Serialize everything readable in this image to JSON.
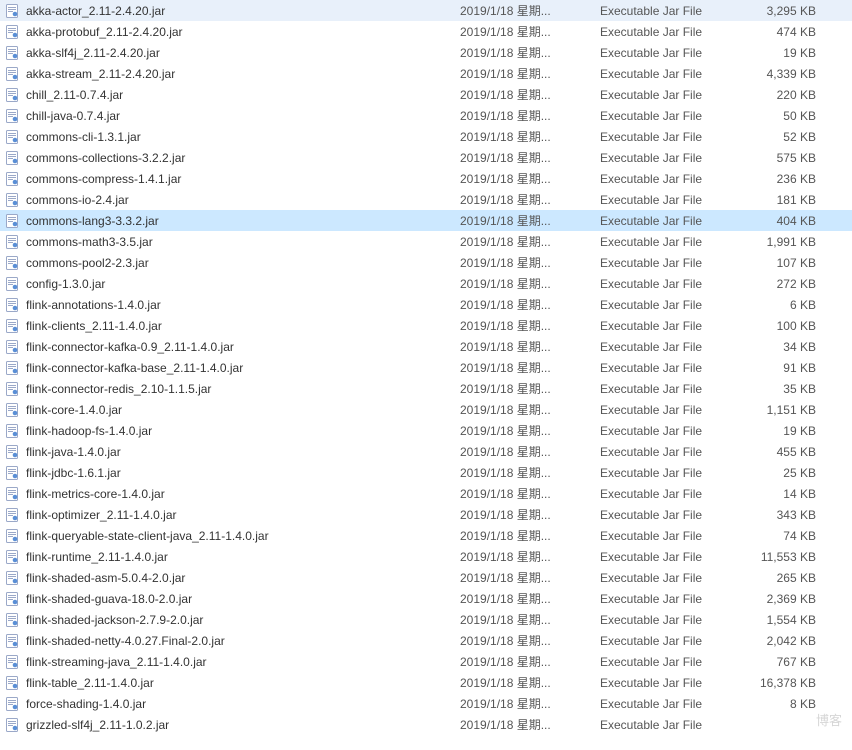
{
  "watermark": "博客",
  "icon_name": "jar-file-icon",
  "files": [
    {
      "name": "akka-actor_2.11-2.4.20.jar",
      "date": "2019/1/18 星期...",
      "type": "Executable Jar File",
      "size": "3,295 KB",
      "selected": false
    },
    {
      "name": "akka-protobuf_2.11-2.4.20.jar",
      "date": "2019/1/18 星期...",
      "type": "Executable Jar File",
      "size": "474 KB",
      "selected": false
    },
    {
      "name": "akka-slf4j_2.11-2.4.20.jar",
      "date": "2019/1/18 星期...",
      "type": "Executable Jar File",
      "size": "19 KB",
      "selected": false
    },
    {
      "name": "akka-stream_2.11-2.4.20.jar",
      "date": "2019/1/18 星期...",
      "type": "Executable Jar File",
      "size": "4,339 KB",
      "selected": false
    },
    {
      "name": "chill_2.11-0.7.4.jar",
      "date": "2019/1/18 星期...",
      "type": "Executable Jar File",
      "size": "220 KB",
      "selected": false
    },
    {
      "name": "chill-java-0.7.4.jar",
      "date": "2019/1/18 星期...",
      "type": "Executable Jar File",
      "size": "50 KB",
      "selected": false
    },
    {
      "name": "commons-cli-1.3.1.jar",
      "date": "2019/1/18 星期...",
      "type": "Executable Jar File",
      "size": "52 KB",
      "selected": false
    },
    {
      "name": "commons-collections-3.2.2.jar",
      "date": "2019/1/18 星期...",
      "type": "Executable Jar File",
      "size": "575 KB",
      "selected": false
    },
    {
      "name": "commons-compress-1.4.1.jar",
      "date": "2019/1/18 星期...",
      "type": "Executable Jar File",
      "size": "236 KB",
      "selected": false
    },
    {
      "name": "commons-io-2.4.jar",
      "date": "2019/1/18 星期...",
      "type": "Executable Jar File",
      "size": "181 KB",
      "selected": false
    },
    {
      "name": "commons-lang3-3.3.2.jar",
      "date": "2019/1/18 星期...",
      "type": "Executable Jar File",
      "size": "404 KB",
      "selected": true
    },
    {
      "name": "commons-math3-3.5.jar",
      "date": "2019/1/18 星期...",
      "type": "Executable Jar File",
      "size": "1,991 KB",
      "selected": false
    },
    {
      "name": "commons-pool2-2.3.jar",
      "date": "2019/1/18 星期...",
      "type": "Executable Jar File",
      "size": "107 KB",
      "selected": false
    },
    {
      "name": "config-1.3.0.jar",
      "date": "2019/1/18 星期...",
      "type": "Executable Jar File",
      "size": "272 KB",
      "selected": false
    },
    {
      "name": "flink-annotations-1.4.0.jar",
      "date": "2019/1/18 星期...",
      "type": "Executable Jar File",
      "size": "6 KB",
      "selected": false
    },
    {
      "name": "flink-clients_2.11-1.4.0.jar",
      "date": "2019/1/18 星期...",
      "type": "Executable Jar File",
      "size": "100 KB",
      "selected": false
    },
    {
      "name": "flink-connector-kafka-0.9_2.11-1.4.0.jar",
      "date": "2019/1/18 星期...",
      "type": "Executable Jar File",
      "size": "34 KB",
      "selected": false
    },
    {
      "name": "flink-connector-kafka-base_2.11-1.4.0.jar",
      "date": "2019/1/18 星期...",
      "type": "Executable Jar File",
      "size": "91 KB",
      "selected": false
    },
    {
      "name": "flink-connector-redis_2.10-1.1.5.jar",
      "date": "2019/1/18 星期...",
      "type": "Executable Jar File",
      "size": "35 KB",
      "selected": false
    },
    {
      "name": "flink-core-1.4.0.jar",
      "date": "2019/1/18 星期...",
      "type": "Executable Jar File",
      "size": "1,151 KB",
      "selected": false
    },
    {
      "name": "flink-hadoop-fs-1.4.0.jar",
      "date": "2019/1/18 星期...",
      "type": "Executable Jar File",
      "size": "19 KB",
      "selected": false
    },
    {
      "name": "flink-java-1.4.0.jar",
      "date": "2019/1/18 星期...",
      "type": "Executable Jar File",
      "size": "455 KB",
      "selected": false
    },
    {
      "name": "flink-jdbc-1.6.1.jar",
      "date": "2019/1/18 星期...",
      "type": "Executable Jar File",
      "size": "25 KB",
      "selected": false
    },
    {
      "name": "flink-metrics-core-1.4.0.jar",
      "date": "2019/1/18 星期...",
      "type": "Executable Jar File",
      "size": "14 KB",
      "selected": false
    },
    {
      "name": "flink-optimizer_2.11-1.4.0.jar",
      "date": "2019/1/18 星期...",
      "type": "Executable Jar File",
      "size": "343 KB",
      "selected": false
    },
    {
      "name": "flink-queryable-state-client-java_2.11-1.4.0.jar",
      "date": "2019/1/18 星期...",
      "type": "Executable Jar File",
      "size": "74 KB",
      "selected": false
    },
    {
      "name": "flink-runtime_2.11-1.4.0.jar",
      "date": "2019/1/18 星期...",
      "type": "Executable Jar File",
      "size": "11,553 KB",
      "selected": false
    },
    {
      "name": "flink-shaded-asm-5.0.4-2.0.jar",
      "date": "2019/1/18 星期...",
      "type": "Executable Jar File",
      "size": "265 KB",
      "selected": false
    },
    {
      "name": "flink-shaded-guava-18.0-2.0.jar",
      "date": "2019/1/18 星期...",
      "type": "Executable Jar File",
      "size": "2,369 KB",
      "selected": false
    },
    {
      "name": "flink-shaded-jackson-2.7.9-2.0.jar",
      "date": "2019/1/18 星期...",
      "type": "Executable Jar File",
      "size": "1,554 KB",
      "selected": false
    },
    {
      "name": "flink-shaded-netty-4.0.27.Final-2.0.jar",
      "date": "2019/1/18 星期...",
      "type": "Executable Jar File",
      "size": "2,042 KB",
      "selected": false
    },
    {
      "name": "flink-streaming-java_2.11-1.4.0.jar",
      "date": "2019/1/18 星期...",
      "type": "Executable Jar File",
      "size": "767 KB",
      "selected": false
    },
    {
      "name": "flink-table_2.11-1.4.0.jar",
      "date": "2019/1/18 星期...",
      "type": "Executable Jar File",
      "size": "16,378 KB",
      "selected": false
    },
    {
      "name": "force-shading-1.4.0.jar",
      "date": "2019/1/18 星期...",
      "type": "Executable Jar File",
      "size": "8 KB",
      "selected": false
    },
    {
      "name": "grizzled-slf4j_2.11-1.0.2.jar",
      "date": "2019/1/18 星期...",
      "type": "Executable Jar File",
      "size": "",
      "selected": false
    }
  ]
}
